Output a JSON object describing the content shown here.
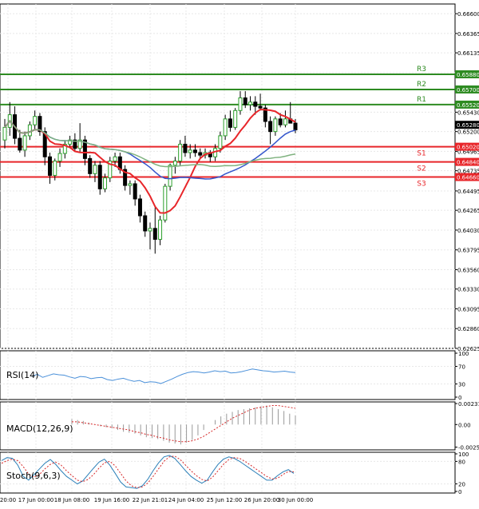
{
  "colors": {
    "up": "#2ca02c",
    "down": "#d62728",
    "support": "#e8262a",
    "resistance": "#2e8b22",
    "ma_red": "#e8262a",
    "ma_blue": "#3355cc",
    "ma_green": "#7fb27f",
    "rsi": "#4a90d9",
    "macd_signal": "#d62728",
    "stoch_main": "#2a7fb8",
    "stoch_signal": "#d62728",
    "grid": "#e8e8e8"
  },
  "chart_data": [
    {
      "type": "candlestick",
      "panel": "price",
      "y_ticks": [
        "0.66600",
        "0.66365",
        "0.66135",
        "0.65900",
        "0.65430",
        "0.65200",
        "0.64965",
        "0.64735",
        "0.64495",
        "0.64265",
        "0.64030",
        "0.63795",
        "0.63560",
        "0.63330",
        "0.63095",
        "0.62860",
        "0.62625"
      ],
      "ylim": [
        0.62625,
        0.66715
      ],
      "x_ticks": [
        "20:00",
        "17 Jun 00:00",
        "18 Jun 08:00",
        "19 Jun 16:00",
        "22 Jun 21:01",
        "24 Jun 04:00",
        "25 Jun 12:00",
        "26 Jun 20:00",
        "30 Jun 00:00"
      ],
      "current_price": "0.65280",
      "levels": [
        {
          "name": "R3",
          "value": 0.6588,
          "label": "0.65880",
          "kind": "resistance"
        },
        {
          "name": "R2",
          "value": 0.657,
          "label": "0.65700",
          "kind": "resistance"
        },
        {
          "name": "R1",
          "value": 0.6552,
          "label": "0.65520",
          "kind": "resistance"
        },
        {
          "name": "S1",
          "value": 0.6502,
          "label": "0.65020",
          "kind": "support"
        },
        {
          "name": "S2",
          "value": 0.6484,
          "label": "0.64840",
          "kind": "support"
        },
        {
          "name": "S3",
          "value": 0.6466,
          "label": "0.64660",
          "kind": "support"
        }
      ],
      "candles": [
        [
          0.651,
          0.6535,
          0.65,
          0.6525
        ],
        [
          0.6525,
          0.6555,
          0.6515,
          0.654
        ],
        [
          0.654,
          0.655,
          0.6505,
          0.6512
        ],
        [
          0.6512,
          0.6522,
          0.6495,
          0.6498
        ],
        [
          0.6498,
          0.652,
          0.649,
          0.6515
        ],
        [
          0.6515,
          0.6532,
          0.651,
          0.6528
        ],
        [
          0.6528,
          0.6545,
          0.6522,
          0.6538
        ],
        [
          0.6538,
          0.6542,
          0.6515,
          0.652
        ],
        [
          0.652,
          0.6525,
          0.648,
          0.649
        ],
        [
          0.649,
          0.6495,
          0.6458,
          0.6468
        ],
        [
          0.6468,
          0.6488,
          0.6462,
          0.6485
        ],
        [
          0.6485,
          0.65,
          0.6478,
          0.6494
        ],
        [
          0.6494,
          0.651,
          0.6488,
          0.6505
        ],
        [
          0.6505,
          0.6515,
          0.65,
          0.651
        ],
        [
          0.651,
          0.6518,
          0.6496,
          0.65
        ],
        [
          0.65,
          0.653,
          0.6495,
          0.651
        ],
        [
          0.651,
          0.6515,
          0.648,
          0.6488
        ],
        [
          0.6488,
          0.6492,
          0.6465,
          0.647
        ],
        [
          0.647,
          0.6485,
          0.646,
          0.648
        ],
        [
          0.648,
          0.6485,
          0.6445,
          0.6452
        ],
        [
          0.6452,
          0.647,
          0.6448,
          0.6465
        ],
        [
          0.6465,
          0.649,
          0.646,
          0.6485
        ],
        [
          0.6485,
          0.6495,
          0.6478,
          0.649
        ],
        [
          0.649,
          0.6495,
          0.647,
          0.6475
        ],
        [
          0.6475,
          0.648,
          0.645,
          0.6456
        ],
        [
          0.6456,
          0.6462,
          0.6445,
          0.6458
        ],
        [
          0.6458,
          0.6462,
          0.6432,
          0.644
        ],
        [
          0.644,
          0.6445,
          0.6412,
          0.642
        ],
        [
          0.642,
          0.6425,
          0.6395,
          0.6402
        ],
        [
          0.6402,
          0.6412,
          0.638,
          0.6405
        ],
        [
          0.6405,
          0.643,
          0.6375,
          0.6392
        ],
        [
          0.6392,
          0.642,
          0.6385,
          0.6415
        ],
        [
          0.6415,
          0.6458,
          0.6412,
          0.6455
        ],
        [
          0.6455,
          0.6482,
          0.645,
          0.648
        ],
        [
          0.648,
          0.649,
          0.647,
          0.6485
        ],
        [
          0.6485,
          0.651,
          0.648,
          0.6505
        ],
        [
          0.6505,
          0.6515,
          0.649,
          0.6495
        ],
        [
          0.6495,
          0.6505,
          0.6488,
          0.6498
        ],
        [
          0.6498,
          0.6505,
          0.649,
          0.6495
        ],
        [
          0.6495,
          0.65,
          0.6488,
          0.6492
        ],
        [
          0.6492,
          0.65,
          0.6488,
          0.6495
        ],
        [
          0.6495,
          0.6498,
          0.6484,
          0.649
        ],
        [
          0.649,
          0.6505,
          0.6485,
          0.65
        ],
        [
          0.65,
          0.652,
          0.6495,
          0.6515
        ],
        [
          0.6515,
          0.654,
          0.651,
          0.6535
        ],
        [
          0.6535,
          0.6545,
          0.652,
          0.6525
        ],
        [
          0.6525,
          0.6548,
          0.6522,
          0.6545
        ],
        [
          0.6545,
          0.6568,
          0.654,
          0.656
        ],
        [
          0.656,
          0.6568,
          0.6548,
          0.6552
        ],
        [
          0.6552,
          0.6562,
          0.6545,
          0.6555
        ],
        [
          0.6555,
          0.6562,
          0.654,
          0.655
        ],
        [
          0.655,
          0.6565,
          0.6545,
          0.6548
        ],
        [
          0.6548,
          0.6552,
          0.6525,
          0.6532
        ],
        [
          0.6532,
          0.6538,
          0.6505,
          0.652
        ],
        [
          0.652,
          0.6538,
          0.6515,
          0.6535
        ],
        [
          0.6535,
          0.6542,
          0.6525,
          0.6528
        ],
        [
          0.6528,
          0.6545,
          0.6525,
          0.6535
        ],
        [
          0.6535,
          0.6555,
          0.653,
          0.653
        ],
        [
          0.653,
          0.6535,
          0.6518,
          0.6522
        ]
      ]
    },
    {
      "type": "line",
      "panel": "indicator",
      "label": "RSI(14)",
      "y_ticks": [
        "100",
        "70",
        "30",
        "0"
      ],
      "ylim": [
        0,
        100
      ],
      "values": [
        47,
        52,
        45,
        49,
        53,
        51,
        50,
        46,
        43,
        47,
        46,
        42,
        44,
        45,
        40,
        38,
        41,
        43,
        39,
        36,
        38,
        33,
        35,
        34,
        31,
        36,
        41,
        47,
        52,
        56,
        58,
        57,
        55,
        57,
        60,
        58,
        59,
        55,
        56,
        58,
        61,
        64,
        62,
        60,
        59,
        57,
        58,
        59,
        57,
        56
      ]
    },
    {
      "type": "bar_line",
      "panel": "indicator",
      "label": "MACD(12,26,9)",
      "y_ticks": [
        "0.002319",
        "0.00",
        "-0.00250"
      ],
      "ylim": [
        -0.0028,
        0.0025
      ],
      "histogram": [
        0.0006,
        0.0005,
        0.0004,
        0.0002,
        0.0,
        -0.0002,
        -0.0003,
        -0.0004,
        -0.0006,
        -0.0008,
        -0.0009,
        -0.001,
        -0.0012,
        -0.0014,
        -0.0015,
        -0.0016,
        -0.0018,
        -0.002,
        -0.0021,
        -0.0022,
        -0.002,
        -0.0017,
        -0.0012,
        -0.0006,
        0.0,
        0.0005,
        0.0009,
        0.0012,
        0.0014,
        0.0016,
        0.0017,
        0.0018,
        0.0019,
        0.002,
        0.0021,
        0.0019,
        0.0017,
        0.0015,
        0.0012,
        0.001
      ],
      "signal": [
        0.0003,
        0.0003,
        0.0002,
        0.0001,
        0.0,
        -0.0001,
        -0.0002,
        -0.0003,
        -0.0004,
        -0.0005,
        -0.0006,
        -0.0008,
        -0.0009,
        -0.0011,
        -0.0012,
        -0.0014,
        -0.0015,
        -0.0017,
        -0.0018,
        -0.0019,
        -0.0019,
        -0.0018,
        -0.0016,
        -0.0013,
        -0.0009,
        -0.0005,
        -0.0001,
        0.0003,
        0.0007,
        0.001,
        0.0013,
        0.0016,
        0.0018,
        0.0019,
        0.002,
        0.0021,
        0.0021,
        0.002,
        0.0019,
        0.0018
      ]
    },
    {
      "type": "line",
      "panel": "indicator",
      "label": "Stoch(9,6,3)",
      "y_ticks": [
        "100",
        "80",
        "20",
        "0"
      ],
      "ylim": [
        0,
        100
      ],
      "main": [
        82,
        90,
        88,
        70,
        40,
        30,
        45,
        60,
        75,
        85,
        72,
        55,
        40,
        30,
        20,
        28,
        45,
        62,
        78,
        86,
        70,
        48,
        25,
        12,
        10,
        8,
        15,
        32,
        55,
        76,
        92,
        96,
        88,
        72,
        55,
        40,
        30,
        22,
        30,
        52,
        72,
        86,
        92,
        88,
        80,
        70,
        60,
        50,
        40,
        30,
        30,
        42,
        52,
        58,
        48
      ],
      "signal": [
        75,
        82,
        86,
        82,
        66,
        46,
        38,
        45,
        60,
        72,
        78,
        70,
        55,
        42,
        30,
        26,
        32,
        45,
        62,
        76,
        80,
        68,
        48,
        28,
        15,
        10,
        12,
        22,
        40,
        60,
        80,
        92,
        94,
        85,
        70,
        55,
        42,
        32,
        28,
        38,
        55,
        72,
        85,
        90,
        88,
        80,
        70,
        60,
        50,
        40,
        33,
        35,
        45,
        53,
        52
      ]
    }
  ]
}
